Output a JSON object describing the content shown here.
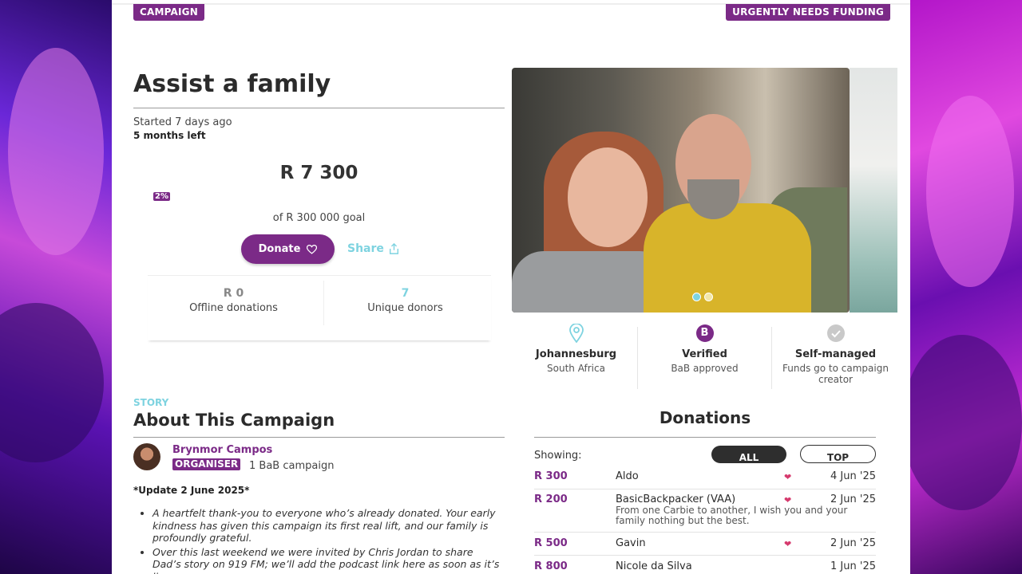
{
  "badges": {
    "campaign": "CAMPAIGN",
    "urgent": "URGENTLY NEEDS FUNDING"
  },
  "campaign": {
    "title": "Assist a family",
    "started": "Started 7 days ago",
    "time_left": "5 months left",
    "raised": "R 7 300",
    "percent": "2%",
    "progress_fraction": 0.02,
    "goal": "of R 300 000 goal",
    "donate_label": "Donate",
    "share_label": "Share"
  },
  "stats": {
    "offline_value": "R 0",
    "offline_label": "Offline donations",
    "donors_value": "7",
    "donors_label": "Unique donors"
  },
  "info": [
    {
      "icon": "location-pin-icon",
      "heading": "Johannesburg",
      "sub": "South Africa"
    },
    {
      "icon": "verified-b-icon",
      "icon_text": "B",
      "heading": "Verified",
      "sub": "BaB approved"
    },
    {
      "icon": "check-circle-icon",
      "heading": "Self-managed",
      "sub": "Funds go to campaign creator"
    }
  ],
  "story": {
    "tag": "STORY",
    "title": "About This Campaign",
    "organiser_name": "Brynmor Campos",
    "organiser_badge": "ORGANISER",
    "organiser_campaigns": "1 BaB campaign",
    "update_heading": "*Update 2 June 2025*",
    "bullets": [
      "A heartfelt thank-you to everyone who’s already donated. Your early kindness has given this campaign its first real lift, and our family is profoundly grateful.",
      "Over this last weekend we were invited by Chris Jordan to share Dad’s story on 919 FM; we’ll add the podcast link here as soon as it’s live"
    ]
  },
  "donations": {
    "title": "Donations",
    "showing_label": "Showing:",
    "filter_all": "ALL",
    "filter_top": "TOP",
    "rows": [
      {
        "amount": "R 300",
        "name": "Aldo",
        "message": "",
        "date": "4 Jun '25"
      },
      {
        "amount": "R 200",
        "name": "BasicBackpacker (VAA)",
        "message": "From one Carbie to another, I wish you and your family nothing but the best.",
        "date": "2 Jun '25"
      },
      {
        "amount": "R 500",
        "name": "Gavin",
        "message": "",
        "date": "2 Jun '25"
      },
      {
        "amount": "R 800",
        "name": "Nicole da Silva",
        "message": "",
        "date": "1 Jun '25"
      }
    ]
  },
  "colors": {
    "brand": "#7b2a87",
    "accent": "#7ed3e0"
  }
}
